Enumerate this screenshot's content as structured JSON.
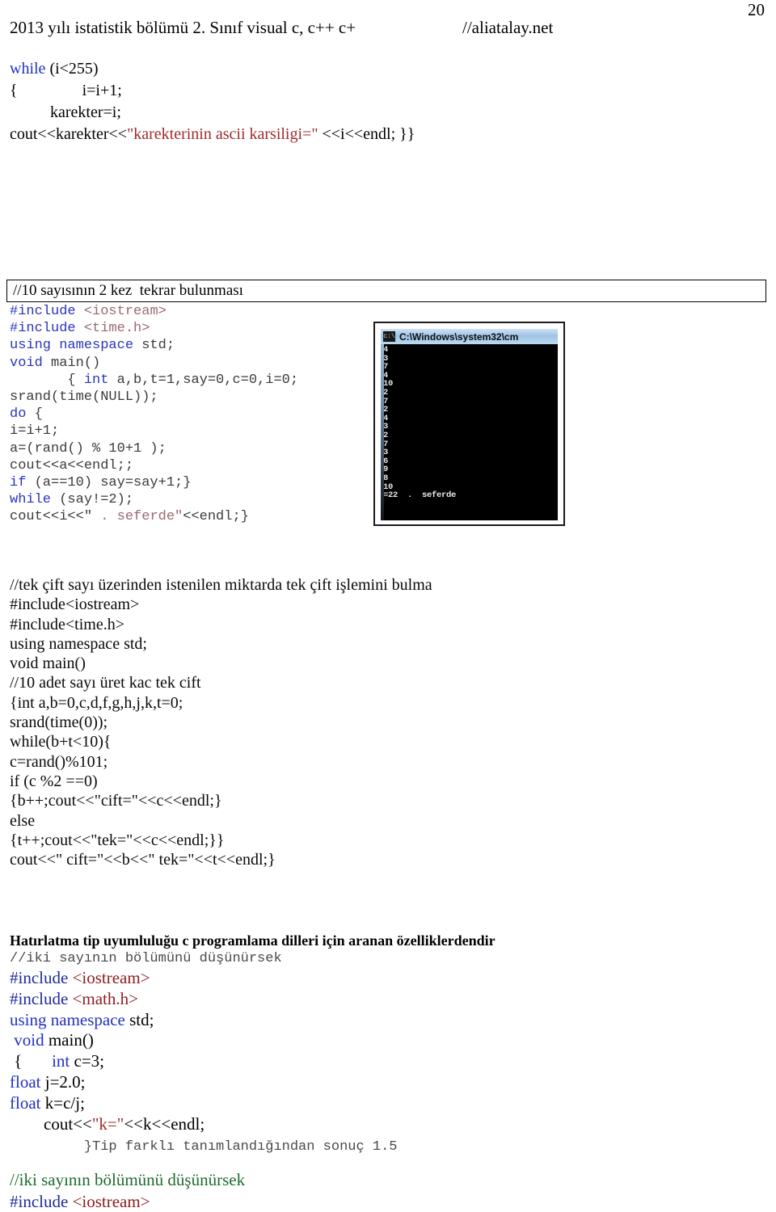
{
  "page": {
    "number": "20"
  },
  "header": {
    "left": "2013 yılı istatistik bölümü 2. Sınıf visual c, c++ c+",
    "right": "//aliatalay.net"
  },
  "snippet_top": {
    "line1_kw": "while",
    "line1_rest": " (i<255)",
    "line2": "{                i=i+1;",
    "line3": "          karekter=i;",
    "line4_a": "cout<<karekter<<",
    "line4_str": "\"karekterinin ascii karsiligi=\"",
    "line4_b": " <<i<<endl; }}"
  },
  "boxed_comment": {
    "text": "//10 sayısının 2 kez  tekrar bulunması"
  },
  "code_mono_1": {
    "l1_inc": "#include",
    "l1_hdr": " <iostream>",
    "l2_inc": "#include",
    "l2_hdr": " <time.h>",
    "l3_kw": "using namespace",
    "l3_rest": " std;",
    "l4_kw": "void",
    "l4_rest": " main()",
    "l5_pre": "       { ",
    "l5_kw": "int",
    "l5_rest": " a,b,t=1,say=0,c=0,i=0;",
    "l6": "srand(time(NULL));",
    "l7_kw": "do",
    "l7_rest": " {",
    "l8": "i=i+1;",
    "l9": "a=(rand() % 10+1 );",
    "l10": "cout<<a<<endl;;",
    "l11_kw": "if",
    "l11_rest": " (a==10) say=say+1;}",
    "l12_kw": "while",
    "l12_rest": " (say!=2);",
    "l13_pre": "cout<<i<<\"",
    "l13_str": " . seferde\"",
    "l13_post": "<<endl;}"
  },
  "console": {
    "title": "C:\\Windows\\system32\\cm",
    "cmd_icon_label": "c:\\",
    "output": "4\n3\n7\n4\n10\n2\n7\n2\n4\n3\n2\n7\n3\n6\n9\n8\n10\n=22  .  seferde"
  },
  "code_plain_2": {
    "lines": [
      "//tek çift sayı üzerinden istenilen miktarda tek çift işlemini bulma",
      "#include<iostream>",
      "#include<time.h>",
      "using namespace std;",
      "void main()",
      "//10 adet sayı üret kac tek cift",
      "{int a,b=0,c,d,f,g,h,j,k,t=0;",
      "srand(time(0));",
      "while(b+t<10){",
      "c=rand()%101;",
      "if (c %2 ==0)",
      "{b++;cout<<\"cift=\"<<c<<endl;}",
      "else",
      "{t++;cout<<\"tek=\"<<c<<endl;}}",
      "cout<<\" cift=\"<<b<<\" tek=\"<<t<<endl;}"
    ]
  },
  "reminder": {
    "text": "Hatırlatma tip uyumluluğu c programlama dilleri için aranan özelliklerdendir"
  },
  "mono_comment_1": {
    "text": "//iki sayının bölümünü düşünürsek"
  },
  "code_color_3": {
    "l1_inc": "#include",
    "l1_hdr": " <iostream>",
    "l2_inc": "#include",
    "l2_hdr": " <math.h>",
    "l3_kw": "using namespace",
    "l3_rest": " std;",
    "l4_kw": " void",
    "l4_rest": " main()",
    "l5_pre": " {       ",
    "l5_kw": "int",
    "l5_rest": " c=3;",
    "l6_kw": "float",
    "l6_rest": " j=2.0;",
    "l7_kw": "float",
    "l7_rest": " k=c/j;",
    "l8_pre": "        cout<<",
    "l8_str": "\"k=\"",
    "l8_post": "<<k<<endl;",
    "l9_mono": "         }Tip farklı tanımlandığından sonuç 1.5"
  },
  "code_color_4": {
    "l1_cmt": "//iki sayının bölümünü düşünürsek",
    "l2_inc": "#include",
    "l2_hdr": " <iostream>"
  },
  "colors": {
    "keyword_blue": "#2231c0",
    "string_red": "#9e2a2a",
    "comment_green": "#1b6b2e",
    "include_blue": "#1e2a9c",
    "header_red": "#8c1f22",
    "mono_keyword": "#2a35b8",
    "mono_string": "#9a6a72",
    "mono_body": "#3b3b3b",
    "console_bg": "#000000",
    "console_text": "#e8e8e8",
    "titlebar": "#9fc3e6"
  }
}
